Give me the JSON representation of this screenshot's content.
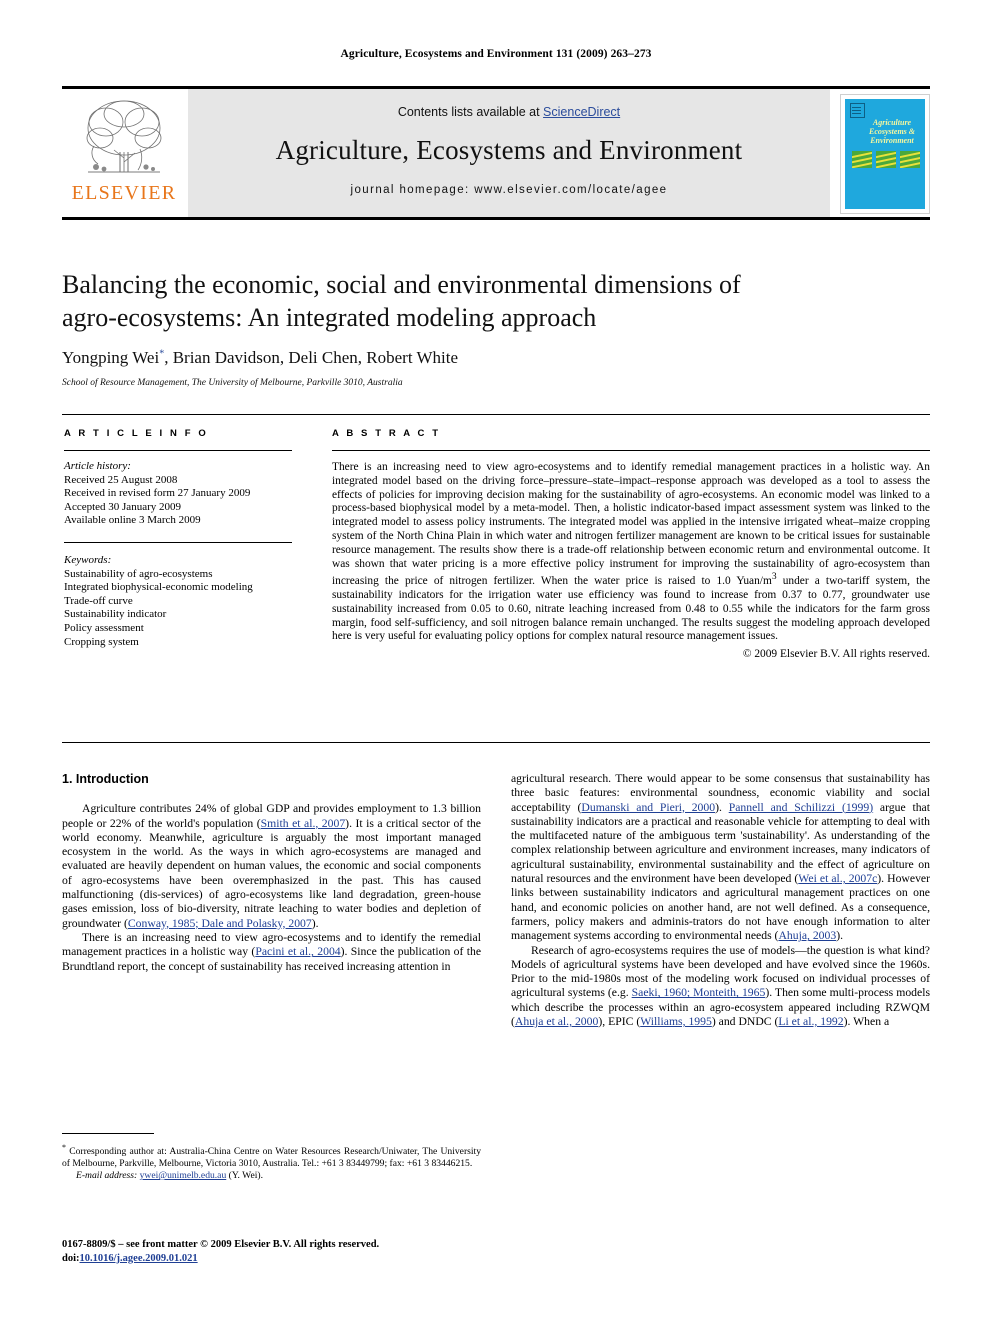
{
  "running_head": "Agriculture, Ecosystems and Environment 131 (2009) 263–273",
  "masthead": {
    "contents_prefix": "Contents lists available at ",
    "sciencedirect": "ScienceDirect",
    "journal_name": "Agriculture, Ecosystems and Environment",
    "homepage": "journal homepage: www.elsevier.com/locate/agee",
    "publisher_wordmark": "ELSEVIER",
    "cover_title": "Agriculture Ecosystems & Environment",
    "accent_orange": "#E8761B",
    "cover_blue": "#1fa8dd",
    "link_blue": "#2b4c9b"
  },
  "article": {
    "title": "Balancing the economic, social and environmental dimensions of agro-ecosystems: An integrated modeling approach",
    "authors": "Yongping Wei",
    "corresponding_marker": "*",
    "authors_rest": ", Brian Davidson, Deli Chen, Robert White",
    "affiliation": "School of Resource Management, The University of Melbourne, Parkville 3010, Australia"
  },
  "article_info": {
    "heading": "A R T I C L E   I N F O",
    "history_label": "Article history:",
    "history": [
      "Received 25 August 2008",
      "Received in revised form 27 January 2009",
      "Accepted 30 January 2009",
      "Available online 3 March 2009"
    ],
    "keywords_label": "Keywords:",
    "keywords": [
      "Sustainability of agro-ecosystems",
      "Integrated biophysical-economic modeling",
      "Trade-off curve",
      "Sustainability indicator",
      "Policy assessment",
      "Cropping system"
    ]
  },
  "abstract": {
    "heading": "A B S T R A C T",
    "text_part1": "There is an increasing need to view agro-ecosystems and to identify remedial management practices in a holistic way. An integrated model based on the driving force–pressure–state–impact–response approach was developed as a tool to assess the effects of policies for improving decision making for the sustainability of agro-ecosystems. An economic model was linked to a process-based biophysical model by a meta-model. Then, a holistic indicator-based impact assessment system was linked to the integrated model to assess policy instruments. The integrated model was applied in the intensive irrigated wheat–maize cropping system of the North China Plain in which water and nitrogen fertilizer management are known to be critical issues for sustainable resource management. The results show there is a trade-off relationship between economic return and environmental outcome. It was shown that water pricing is a more effective policy instrument for improving the sustainability of agro-ecosystem than increasing the price of nitrogen fertilizer. When the water price is raised to 1.0 Yuan/m",
    "superscript": "3",
    "text_part2": " under a two-tariff system, the sustainability indicators for the irrigation water use efficiency was found to increase from 0.37 to 0.77, groundwater use sustainability increased from 0.05 to 0.60, nitrate leaching increased from 0.48 to 0.55 while the indicators for the farm gross margin, food self-sufficiency, and soil nitrogen balance remain unchanged. The results suggest the modeling approach developed here is very useful for evaluating policy options for complex natural resource management issues.",
    "copyright": "© 2009 Elsevier B.V. All rights reserved."
  },
  "body": {
    "section_heading": "1. Introduction",
    "left": {
      "p1_a": "Agriculture contributes 24% of global GDP and provides employment to 1.3 billion people or 22% of the world's population (",
      "p1_cite1": "Smith et al., 2007",
      "p1_b": "). It is a critical sector of the world economy. Meanwhile, agriculture is arguably the most important managed ecosystem in the world. As the ways in which agro-ecosystems are managed and evaluated are heavily dependent on human values, the economic and social components of agro-ecosystems have been overemphasized in the past. This has caused malfunctioning (dis-services) of agro-ecosystems like land degradation, green-house gases emission, loss of bio-diversity, nitrate leaching to water bodies and depletion of groundwater (",
      "p1_cite2": "Conway, 1985; Dale and Polasky, 2007",
      "p1_c": ").",
      "p2_a": "There is an increasing need to view agro-ecosystems and to identify the remedial management practices in a holistic way (",
      "p2_cite1": "Pacini et al., 2004",
      "p2_b": "). Since the publication of the Brundtland report, the concept of sustainability has received increasing attention in"
    },
    "right": {
      "p1_a": "agricultural research. There would appear to be some consensus that sustainability has three basic features: environmental soundness, economic viability and social acceptability (",
      "p1_cite1": "Dumanski and Pieri, 2000",
      "p1_b": "). ",
      "p1_cite2": "Pannell and Schilizzi (1999)",
      "p1_c": " argue that sustainability indicators are a practical and reasonable vehicle for attempting to deal with the multifaceted nature of the ambiguous term 'sustainability'. As understanding of the complex relationship between agriculture and environment increases, many indicators of agricultural sustainability, environmental sustainability and the effect of agriculture on natural resources and the environment have been developed (",
      "p1_cite3": "Wei et al., 2007c",
      "p1_d": "). However links between sustainability indicators and agricultural management practices on one hand, and economic policies on another hand, are not well defined. As a consequence, farmers, policy makers and adminis-trators do not have enough information to alter management systems according to environmental needs (",
      "p1_cite4": "Ahuja, 2003",
      "p1_e": ").",
      "p2_a": "Research of agro-ecosystems requires the use of models—the question is what kind? Models of agricultural systems have been developed and have evolved since the 1960s. Prior to the mid-1980s most of the modeling work focused on individual processes of agricultural systems (e.g. ",
      "p2_cite1": "Saeki, 1960; Monteith, 1965",
      "p2_b": "). Then some multi-process models which describe the processes within an agro-ecosystem appeared including RZWQM (",
      "p2_cite2": "Ahuja et al., 2000",
      "p2_c": "), EPIC (",
      "p2_cite3": "Williams, 1995",
      "p2_d": ") and DNDC (",
      "p2_cite4": "Li et al., 1992",
      "p2_e": "). When a"
    }
  },
  "footnotes": {
    "corresponding": "Corresponding author at: Australia-China Centre on Water Resources Research/Uniwater, The University of Melbourne, Parkville, Melbourne, Victoria 3010, Australia. Tel.: +61 3 83449799; fax: +61 3 83446215.",
    "email_label": "E-mail address:",
    "email": "ywei@unimelb.edu.au",
    "email_suffix": "(Y. Wei)."
  },
  "imprint": {
    "issn_line": "0167-8809/$ – see front matter © 2009 Elsevier B.V. All rights reserved.",
    "doi_label": "doi:",
    "doi": "10.1016/j.agee.2009.01.021"
  }
}
